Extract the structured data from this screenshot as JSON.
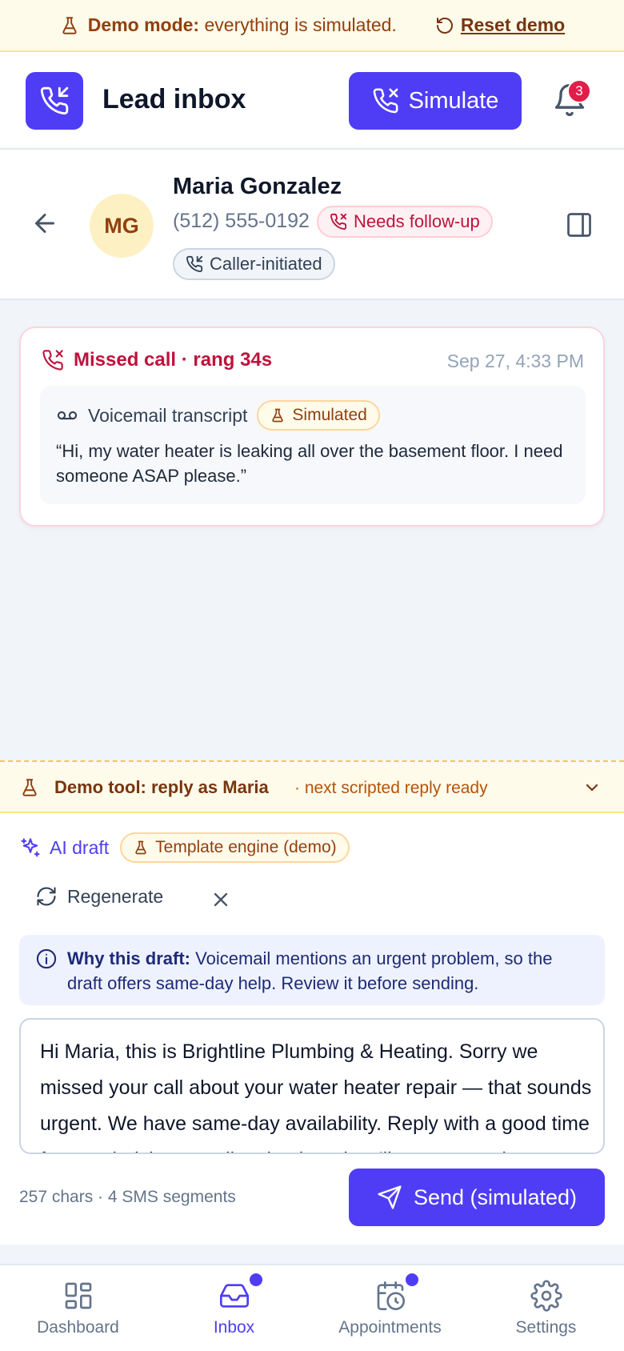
{
  "demo_banner": {
    "bold": "Demo mode:",
    "text": "everything is simulated.",
    "reset_label": "Reset demo",
    "icon": "flask-icon"
  },
  "header": {
    "title": "Lead inbox",
    "simulate_label": "Simulate",
    "notification_count": "3"
  },
  "contact": {
    "initials": "MG",
    "name": "Maria Gonzalez",
    "phone": "(512) 555-0192",
    "status_label": "Needs follow-up",
    "origin_label": "Caller-initiated"
  },
  "call_event": {
    "title": "Missed call · rang 34s",
    "time": "Sep 27, 4:33 PM",
    "voicemail_label": "Voicemail transcript",
    "simulated_label": "Simulated",
    "transcript": "“Hi, my water heater is leaking all over the basement floor. I need someone ASAP please.”"
  },
  "demo_tool": {
    "label": "Demo tool: reply as Maria",
    "sub": "· next scripted reply ready"
  },
  "ai_draft": {
    "label": "AI draft",
    "engine_label": "Template engine (demo)",
    "regenerate_label": "Regenerate",
    "why_bold": "Why this draft:",
    "why_text": "Voicemail mentions an urgent problem, so the draft offers same-day help. Review it before sending.",
    "draft_text": "Hi Maria, this is Brightline Plumbing & Heating. Sorry we missed your call about your water heater repair — that sounds urgent. We have same-day availability. Reply with a good time for a technician or call us back and we'll get you on the schedule.",
    "counter": "257 chars · 4 SMS segments",
    "send_label": "Send (simulated)"
  },
  "bottom_nav": {
    "items": [
      {
        "label": "Dashboard",
        "icon": "dashboard-icon"
      },
      {
        "label": "Inbox",
        "icon": "inbox-icon"
      },
      {
        "label": "Appointments",
        "icon": "calendar-clock-icon"
      },
      {
        "label": "Settings",
        "icon": "gear-icon"
      }
    ]
  },
  "colors": {
    "brand": "#4f3df5",
    "danger": "#be123c",
    "warning_bg": "#fefbeb"
  }
}
